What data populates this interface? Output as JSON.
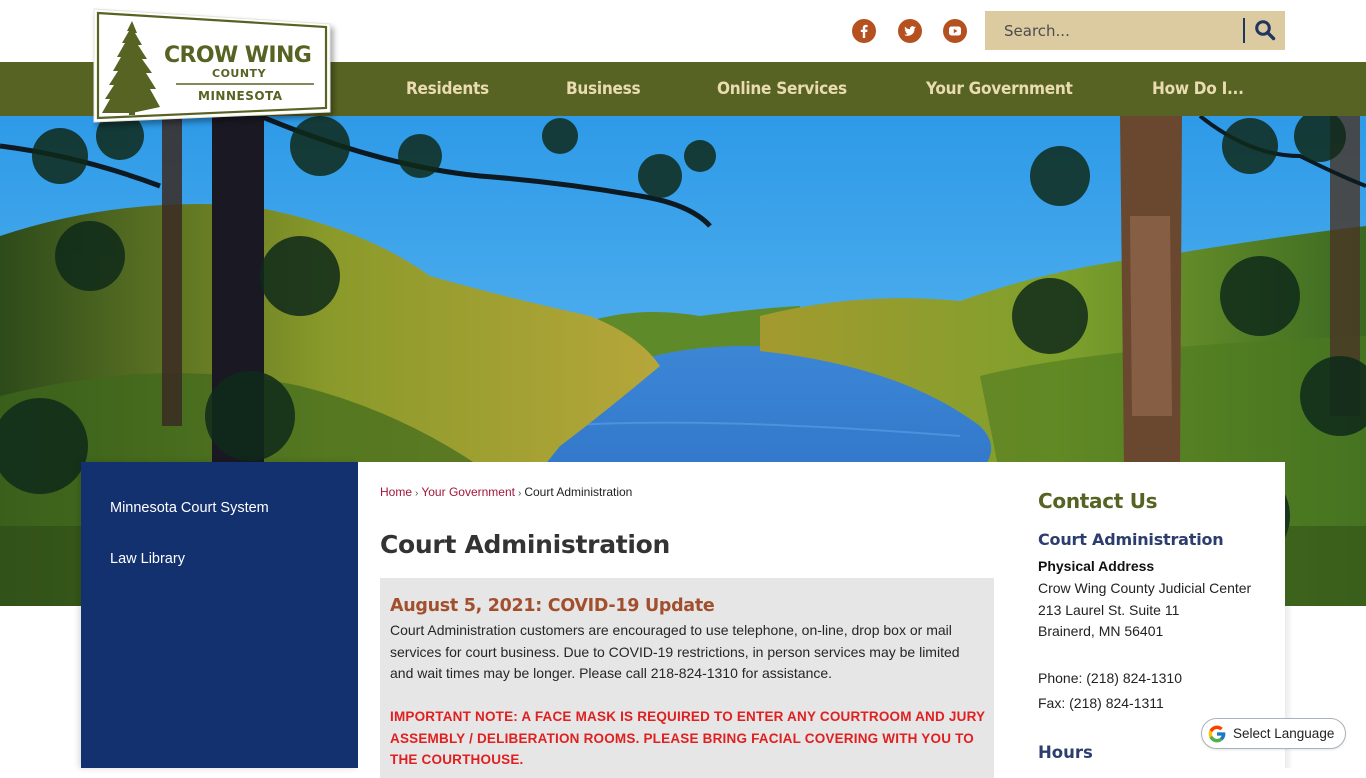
{
  "site": {
    "logo": {
      "line1": "CROW WING",
      "line2": "COUNTY",
      "line3": "MINNESOTA"
    },
    "colors": {
      "nav_green": "#566323",
      "nav_text": "#eadcb0",
      "social_orange": "#b5501f",
      "search_bg": "#dccaa0",
      "sidebar_blue": "#13306f",
      "notice_heading": "#a24f2d",
      "warning_red": "#e02020",
      "breadcrumb_link": "#a0173a"
    }
  },
  "header": {
    "social": [
      {
        "name": "facebook",
        "icon": "facebook-icon"
      },
      {
        "name": "twitter",
        "icon": "twitter-icon"
      },
      {
        "name": "youtube",
        "icon": "youtube-icon"
      }
    ],
    "search": {
      "placeholder": "Search...",
      "value": "",
      "button_icon": "search-icon"
    }
  },
  "nav": {
    "items": [
      {
        "label": "Residents"
      },
      {
        "label": "Business"
      },
      {
        "label": "Online Services"
      },
      {
        "label": "Your Government"
      },
      {
        "label": "How Do I..."
      }
    ]
  },
  "sidebar": {
    "items": [
      {
        "label": "Minnesota Court System"
      },
      {
        "label": "Law Library"
      }
    ]
  },
  "breadcrumb": {
    "items": [
      {
        "label": "Home",
        "link": true
      },
      {
        "label": "Your Government",
        "link": true
      },
      {
        "label": "Court Administration",
        "link": false
      }
    ],
    "separator": "›"
  },
  "main": {
    "title": "Court Administration",
    "notice": {
      "heading": "August 5, 2021: COVID-19 Update",
      "body": "Court Administration customers are encouraged to use telephone, on-line, drop box or mail services for court business. Due to COVID-19 restrictions, in person services may be limited and wait times may be longer. Please call 218-824-1310 for assistance.",
      "warning": "IMPORTANT NOTE:  A FACE MASK IS REQUIRED TO ENTER ANY COURTROOM AND JURY ASSEMBLY / DELIBERATION ROOMS. PLEASE BRING FACIAL COVERING WITH YOU TO THE COURTHOUSE."
    }
  },
  "contact": {
    "heading": "Contact Us",
    "department": "Court Administration",
    "address_label": "Physical Address",
    "address": [
      "Crow Wing County Judicial Center",
      "213 Laurel St. Suite 11",
      "Brainerd, MN 56401"
    ],
    "phone": "Phone: (218) 824-1310",
    "fax": "Fax: (218) 824-1311",
    "hours_heading": "Hours"
  },
  "translate": {
    "label": "Select Language",
    "icon": "google-icon"
  }
}
